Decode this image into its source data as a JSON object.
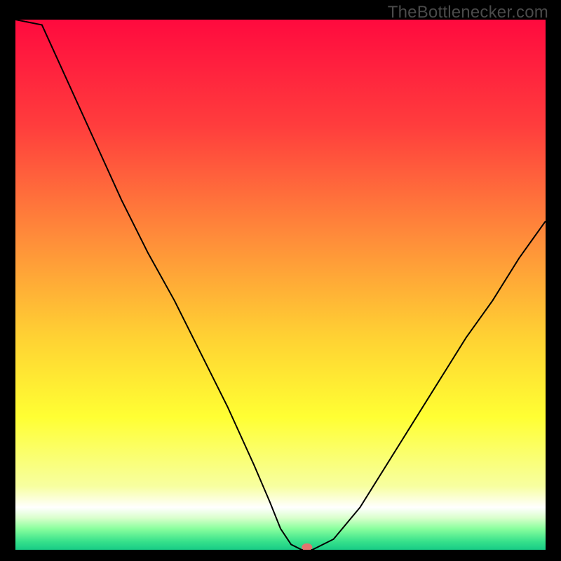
{
  "watermark": "TheBottlenecker.com",
  "colors": {
    "background": "#000000",
    "curve": "#000000",
    "marker": "#e2736f",
    "watermark": "#4a4a4a",
    "gradient_stops": [
      {
        "offset": 0.0,
        "color": "#ff0a3e"
      },
      {
        "offset": 0.2,
        "color": "#ff3d3d"
      },
      {
        "offset": 0.4,
        "color": "#ff883a"
      },
      {
        "offset": 0.6,
        "color": "#ffd233"
      },
      {
        "offset": 0.75,
        "color": "#ffff33"
      },
      {
        "offset": 0.88,
        "color": "#f7ffa0"
      },
      {
        "offset": 0.92,
        "color": "#ffffff"
      },
      {
        "offset": 0.94,
        "color": "#d9ffcc"
      },
      {
        "offset": 0.96,
        "color": "#8aff9e"
      },
      {
        "offset": 0.985,
        "color": "#35e08b"
      },
      {
        "offset": 1.0,
        "color": "#18cc86"
      }
    ]
  },
  "chart_data": {
    "type": "line",
    "title": "",
    "xlabel": "",
    "ylabel": "",
    "xlim": [
      0,
      100
    ],
    "ylim": [
      0,
      100
    ],
    "grid": false,
    "legend": false,
    "series": [
      {
        "name": "bottleneck-curve",
        "x": [
          0,
          5,
          10,
          15,
          20,
          25,
          30,
          35,
          40,
          45,
          48,
          50,
          52,
          54,
          56,
          60,
          65,
          70,
          75,
          80,
          85,
          90,
          95,
          100
        ],
        "y": [
          110,
          99,
          88,
          77,
          66,
          56,
          47,
          37,
          27,
          16,
          9,
          4,
          1,
          0,
          0,
          2,
          8,
          16,
          24,
          32,
          40,
          47,
          55,
          62
        ]
      }
    ],
    "marker": {
      "x": 55,
      "y": 0.5,
      "color": "#e2736f"
    }
  }
}
